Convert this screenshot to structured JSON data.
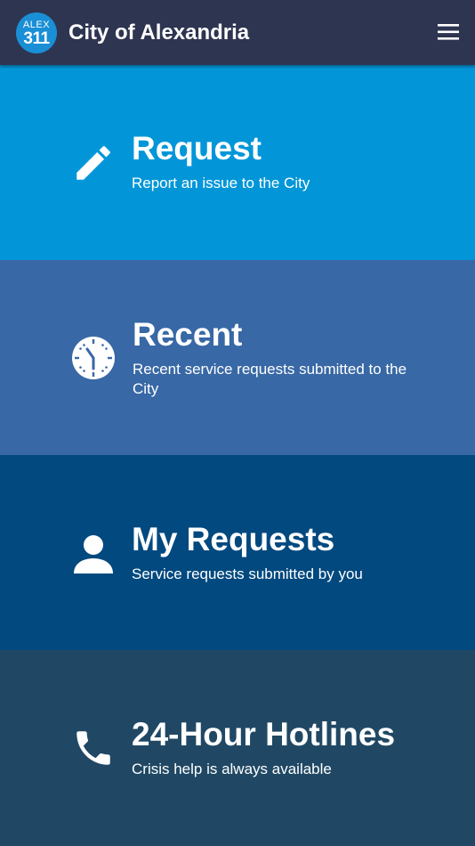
{
  "header": {
    "logo_top": "ALEX",
    "logo_bottom": "311",
    "title": "City of Alexandria",
    "menu_icon": "hamburger-menu-icon"
  },
  "tiles": [
    {
      "title": "Request",
      "description": "Report an issue to the City",
      "icon": "pencil-icon",
      "color": "#0296d9"
    },
    {
      "title": "Recent",
      "description": "Recent service requests submitted to the City",
      "icon": "clock-icon",
      "color": "#3868a5"
    },
    {
      "title": "My Requests",
      "description": "Service requests submitted by you",
      "icon": "person-icon",
      "color": "#01497f"
    },
    {
      "title": "24-Hour Hotlines",
      "description": "Crisis help is always available",
      "icon": "phone-icon",
      "color": "#204864"
    }
  ],
  "colors": {
    "header_bg": "#2e3551",
    "logo_bg": "#1a8fd6",
    "text": "#ffffff"
  }
}
